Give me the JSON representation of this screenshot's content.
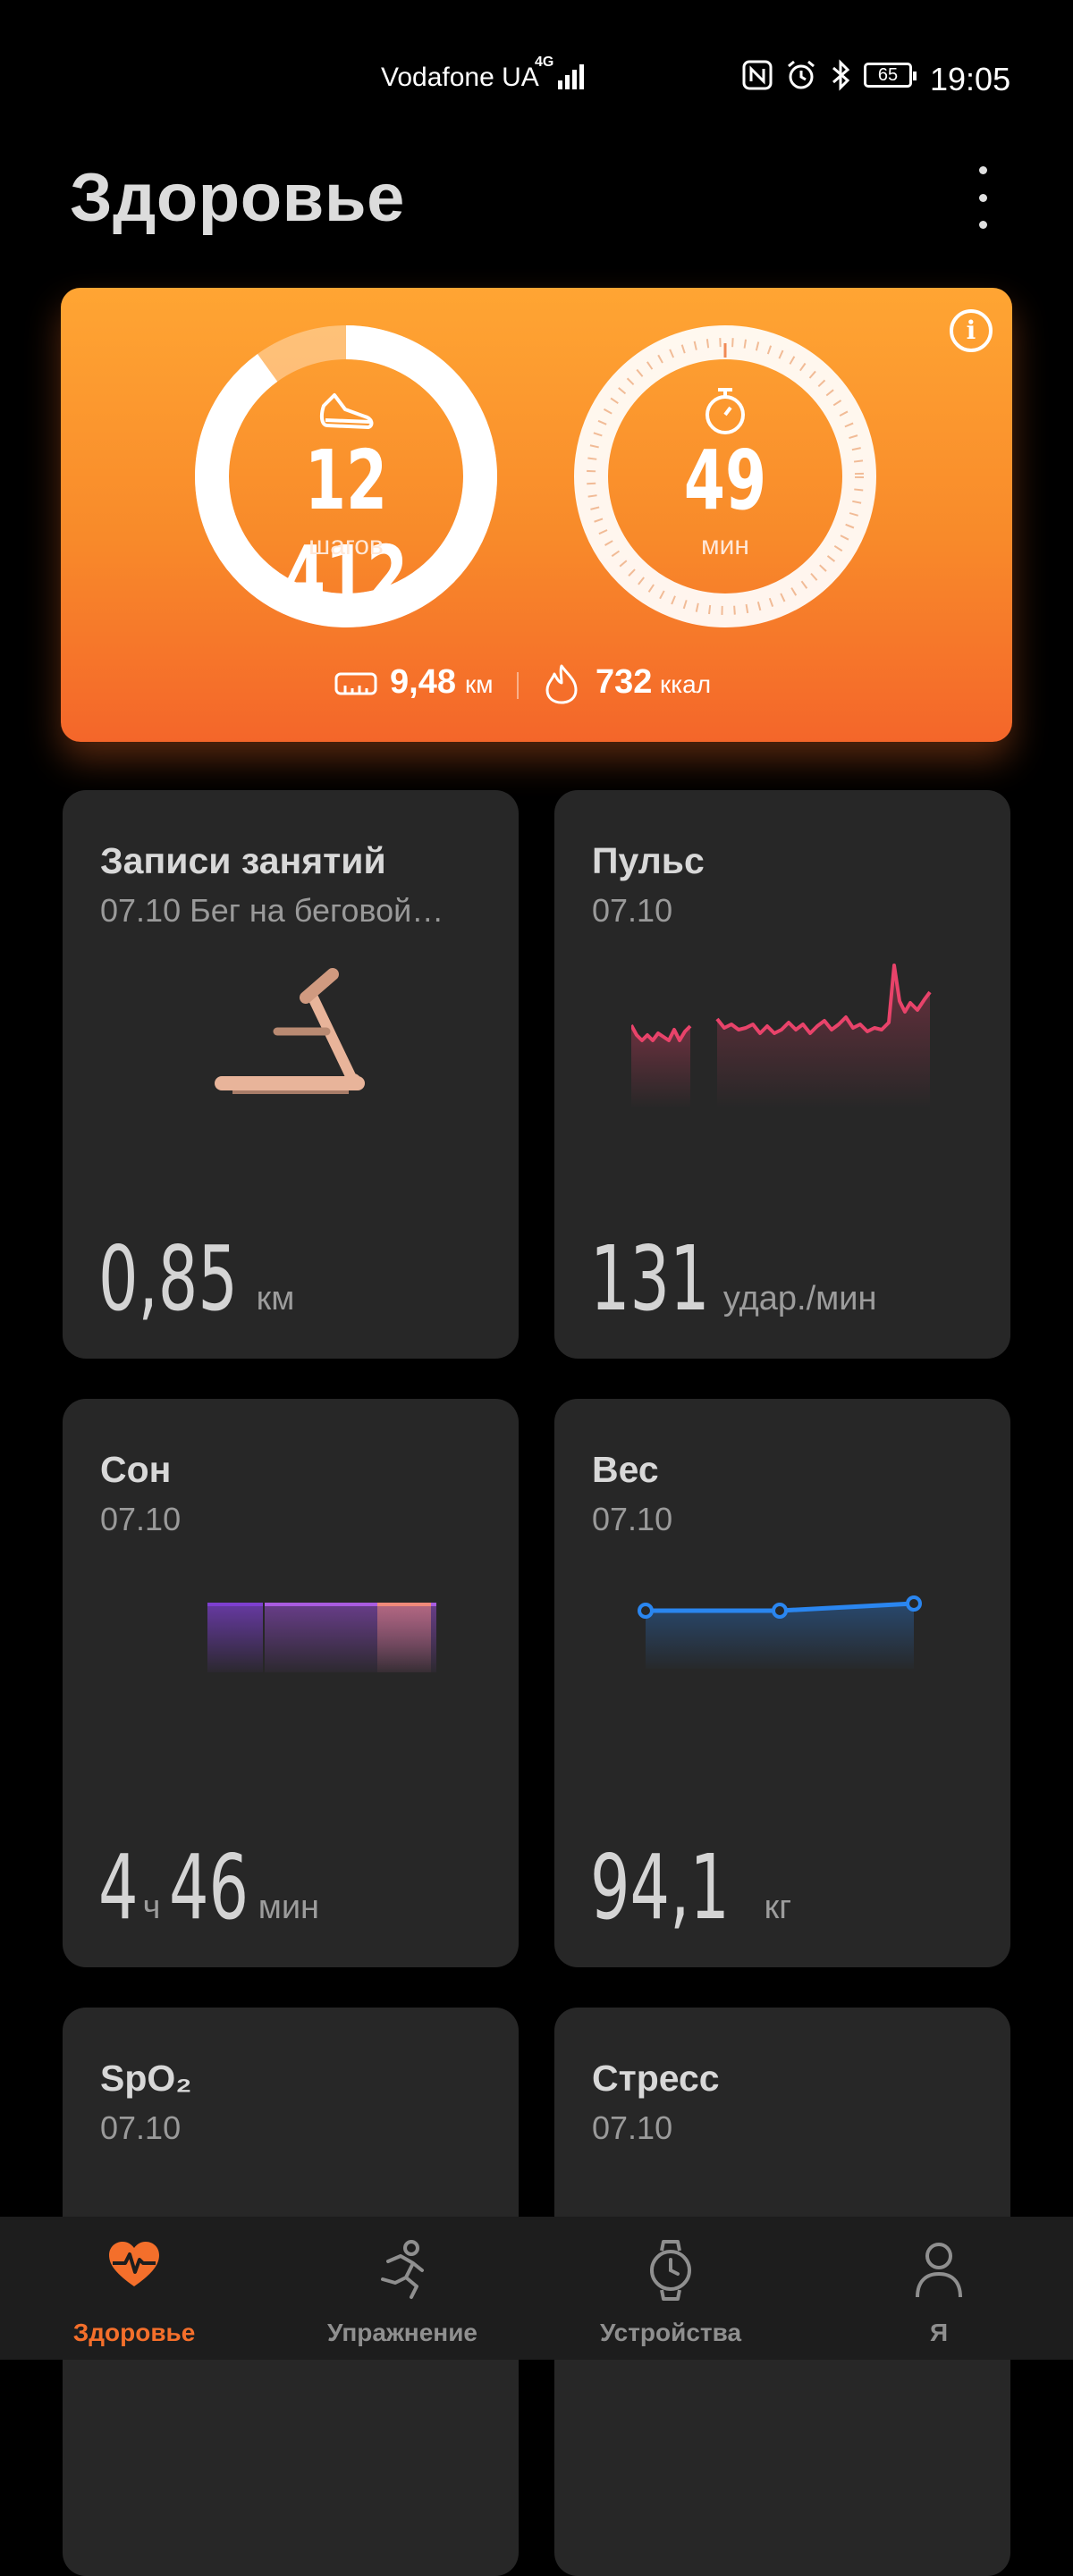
{
  "status_bar": {
    "carrier": "Vodafone UA",
    "network": "4G",
    "battery": "65",
    "time": "19:05"
  },
  "header": {
    "title": "Здоровье"
  },
  "activity": {
    "steps": "12 412",
    "steps_unit": "шагов",
    "steps_progress": 0.9,
    "minutes": "49",
    "minutes_unit": "мин",
    "distance": "9,48",
    "distance_unit": "км",
    "calories": "732",
    "calories_unit": "ккал"
  },
  "tiles": [
    {
      "title": "Записи занятий",
      "subtitle": "07.10 Бег на беговой…",
      "value": "0,85",
      "unit": "км"
    },
    {
      "title": "Пульс",
      "subtitle": "07.10",
      "value": "131",
      "unit": "удар./мин"
    },
    {
      "title": "Сон",
      "subtitle": "07.10",
      "value_h": "4",
      "unit_h": "ч",
      "value_m": "46",
      "unit_m": "мин"
    },
    {
      "title": "Вес",
      "subtitle": "07.10",
      "value": "94,1",
      "unit": "кг"
    },
    {
      "title": "SpO₂",
      "subtitle": "07.10"
    },
    {
      "title": "Стресс",
      "subtitle": "07.10"
    }
  ],
  "nav": [
    {
      "label": "Здоровье",
      "icon": "heart-pulse-icon",
      "active": true
    },
    {
      "label": "Упражнение",
      "icon": "running-icon",
      "active": false
    },
    {
      "label": "Устройства",
      "icon": "watch-icon",
      "active": false
    },
    {
      "label": "Я",
      "icon": "person-icon",
      "active": false
    }
  ],
  "colors": {
    "accent": "#f46f2b",
    "heart": "#e8436a",
    "weight": "#2a86f0",
    "tile_bg": "#272727"
  }
}
